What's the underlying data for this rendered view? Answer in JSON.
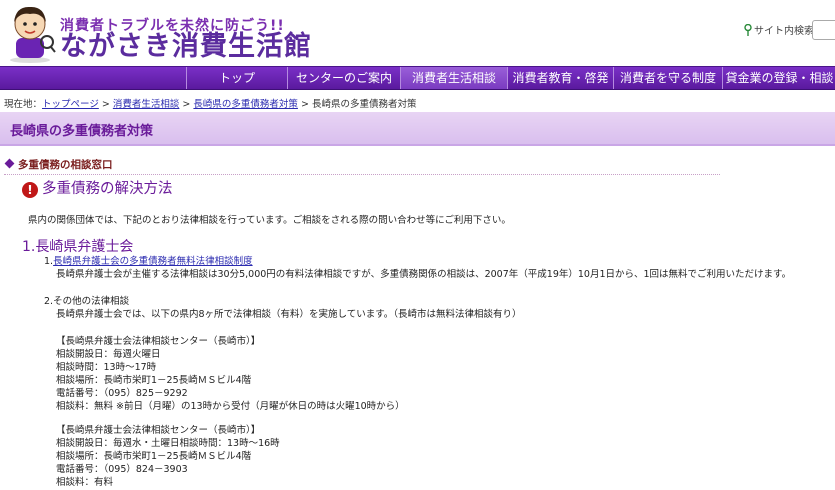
{
  "header": {
    "tagline": "消費者トラブルを未然に防ごう!!",
    "logo": "ながさき消費生活館",
    "search_label": "サイト内検索",
    "search_placeholder": ""
  },
  "nav": {
    "items": [
      {
        "label": "トップ",
        "active": false
      },
      {
        "label": "センターのご案内",
        "active": false
      },
      {
        "label": "消費者生活相談",
        "active": true
      },
      {
        "label": "消費者教育・啓発",
        "active": false
      },
      {
        "label": "消費者を守る制度",
        "active": false
      },
      {
        "label": "貸金業の登録・相談",
        "active": false
      }
    ]
  },
  "breadcrumb": {
    "prefix": "現在地：",
    "items": [
      "トップページ",
      "消費者生活相談",
      "長崎県の多重債務者対策"
    ],
    "separator": ">",
    "current": "長崎県の多重債務者対策"
  },
  "page_title": "長崎県の多重債務者対策",
  "section_heading": "多重債務の相談窓口",
  "subsection_title": "多重債務の解決方法",
  "intro": "県内の関係団体では、下記のとおり法律相談を行っています。ご相談をされる際の問い合わせ等にご利用下さい。",
  "bar_association": {
    "title": "1.長崎県弁護士会",
    "item1": {
      "prefix": "1.",
      "link": "長崎県弁護士会の多重債務者無料法律相談制度",
      "desc": "長崎県弁護士会が主催する法律相談は30分5,000円の有料法律相談ですが、多重債務関係の相談は、2007年（平成19年）10月1日から、1回は無料でご利用いただけます。"
    },
    "item2": {
      "title": "2.その他の法律相談",
      "desc": "長崎県弁護士会では、以下の県内8ヶ所で法律相談（有料）を実施しています。（長崎市は無料法律相談有り）"
    },
    "center1": {
      "name": "【長崎県弁護士会法律相談センター（長崎市）】",
      "days": "相談開設日：毎週火曜日",
      "hours": "相談時間：13時～17時",
      "place": "相談場所：長崎市栄町1－25長崎ＭＳビル4階",
      "phone": "電話番号：（095）825－9292",
      "fee": "相談料：無料 ※前日（月曜）の13時から受付（月曜が休日の時は火曜10時から）"
    },
    "center2": {
      "name": "【長崎県弁護士会法律相談センター（長崎市）】",
      "days_hours": "相談開設日：毎週水・土曜日相談時間：13時～16時",
      "place": "相談場所：長崎市栄町1－25長崎ＭＳビル4階",
      "phone": "電話番号：（095）824－3903",
      "fee": "相談料：有料"
    }
  },
  "colors": {
    "nav_purple": "#6a24b3",
    "title_purple": "#6a1b9a",
    "link_blue": "#2b2bb0",
    "alert_red": "#c01818"
  }
}
